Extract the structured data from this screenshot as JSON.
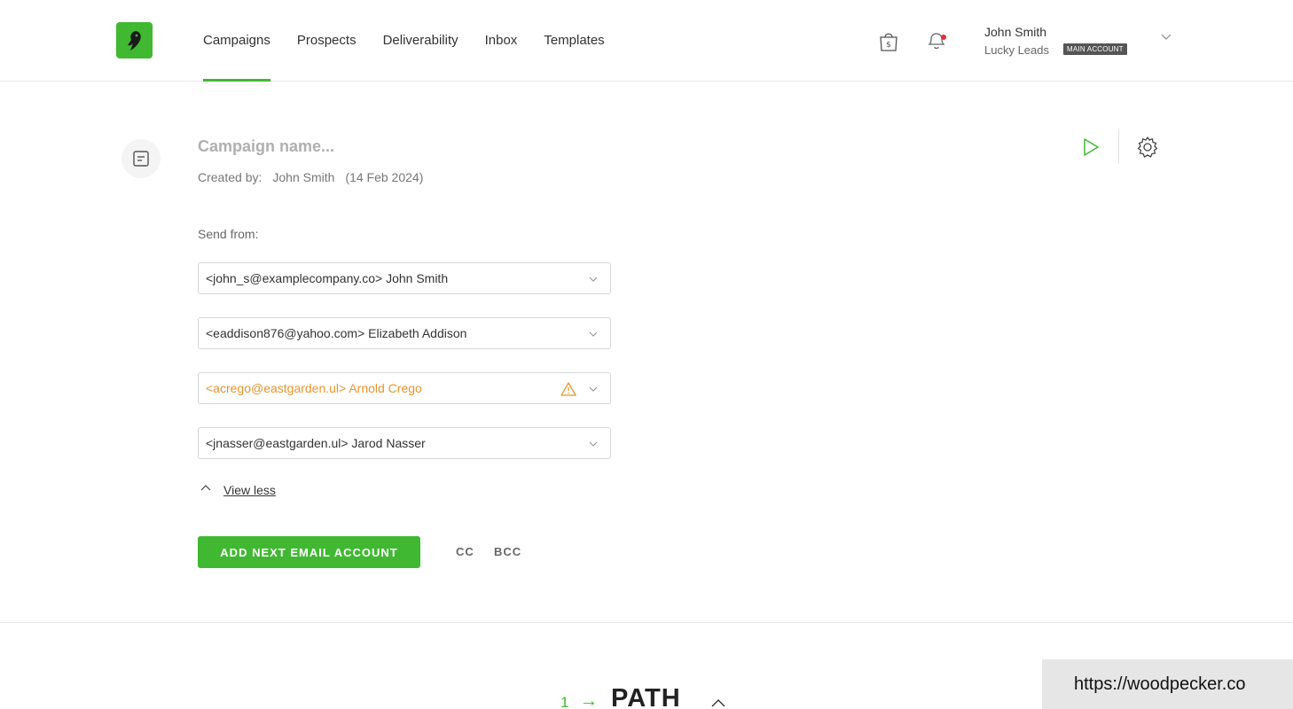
{
  "header": {
    "nav": [
      {
        "label": "Campaigns",
        "active": true
      },
      {
        "label": "Prospects",
        "active": false
      },
      {
        "label": "Deliverability",
        "active": false
      },
      {
        "label": "Inbox",
        "active": false
      },
      {
        "label": "Templates",
        "active": false
      }
    ],
    "user": {
      "name": "John Smith",
      "org": "Lucky Leads",
      "badge": "MAIN ACCOUNT"
    },
    "icons": [
      "logo-icon",
      "shopping-bag-icon",
      "bell-icon",
      "chevron-down-icon"
    ],
    "accent_color": "#41b832",
    "notification_dot_color": "#e0303a"
  },
  "campaign": {
    "name_placeholder": "Campaign name...",
    "created_by_label": "Created by:",
    "created_by_name": "John Smith",
    "created_date": "(14 Feb 2024)"
  },
  "send_from": {
    "label": "Send from:",
    "accounts": [
      {
        "value": "<john_s@examplecompany.co> John Smith",
        "warning": false
      },
      {
        "value": "<eaddison876@yahoo.com> Elizabeth Addison",
        "warning": false
      },
      {
        "value": "<acrego@eastgarden.ul> Arnold Crego",
        "warning": true
      },
      {
        "value": "<jnasser@eastgarden.ul> Jarod Nasser",
        "warning": false
      }
    ],
    "warning_color": "#e8952f",
    "view_less": "View less"
  },
  "actions": {
    "add_account": "ADD NEXT EMAIL ACCOUNT",
    "cc": "CC",
    "bcc": "BCC"
  },
  "path": {
    "step": "1",
    "arrow": "→",
    "title": "PATH"
  },
  "overlay": {
    "url": "https://woodpecker.co"
  }
}
